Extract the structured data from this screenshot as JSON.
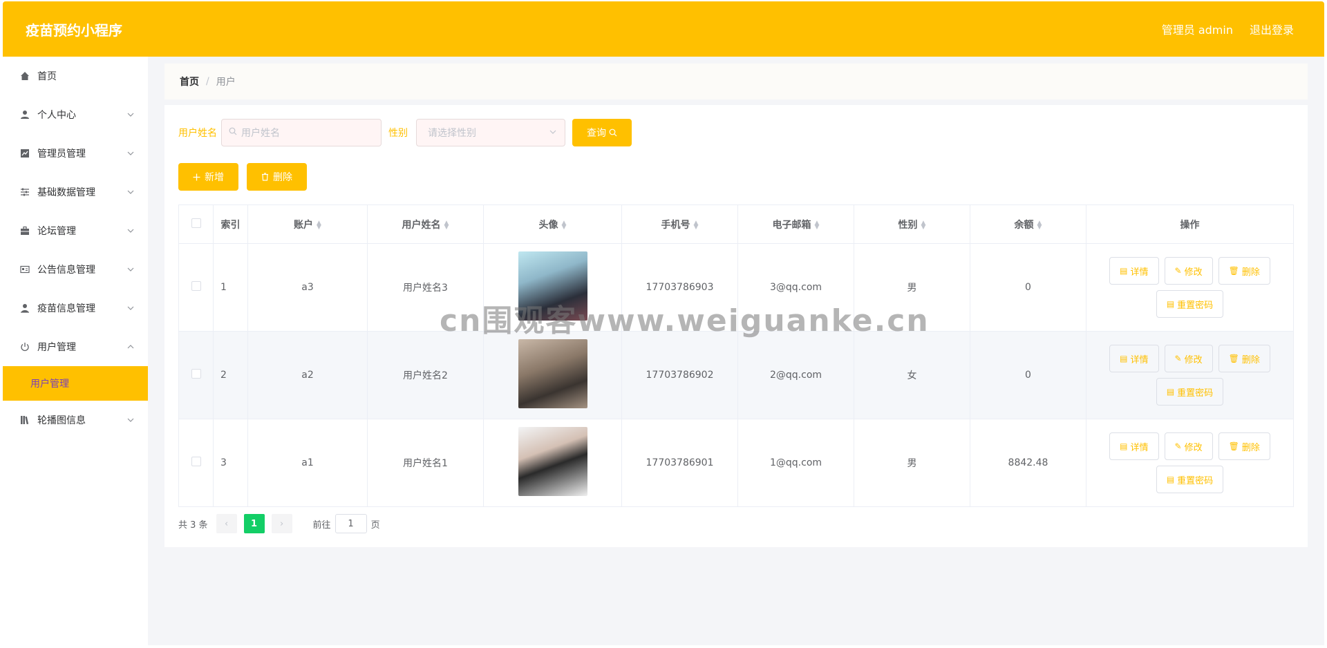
{
  "header": {
    "title": "疫苗预约小程序",
    "admin_label": "管理员 admin",
    "logout_label": "退出登录",
    "accent": "#FFC000"
  },
  "sidebar": {
    "items": [
      {
        "label": "首页",
        "icon": "home-icon"
      },
      {
        "label": "个人中心",
        "icon": "user-icon"
      },
      {
        "label": "管理员管理",
        "icon": "chart-icon"
      },
      {
        "label": "基础数据管理",
        "icon": "sliders-icon"
      },
      {
        "label": "论坛管理",
        "icon": "briefcase-icon"
      },
      {
        "label": "公告信息管理",
        "icon": "id-card-icon"
      },
      {
        "label": "疫苗信息管理",
        "icon": "person-icon"
      },
      {
        "label": "用户管理",
        "icon": "power-icon"
      },
      {
        "label": "轮播图信息",
        "icon": "library-icon"
      }
    ],
    "active_sub": "用户管理"
  },
  "breadcrumb": {
    "home": "首页",
    "sep": "/",
    "current": "用户"
  },
  "search": {
    "name_label": "用户姓名",
    "name_placeholder": "用户姓名",
    "gender_label": "性别",
    "gender_placeholder": "请选择性别",
    "query_button": "查询"
  },
  "actions": {
    "add": "新增",
    "delete": "删除"
  },
  "table": {
    "headers": [
      "索引",
      "账户",
      "用户姓名",
      "头像",
      "手机号",
      "电子邮箱",
      "性别",
      "余额",
      "操作"
    ],
    "rows": [
      {
        "index": "1",
        "account": "a3",
        "name": "用户姓名3",
        "phone": "17703786903",
        "email": "3@qq.com",
        "gender": "男",
        "balance": "0"
      },
      {
        "index": "2",
        "account": "a2",
        "name": "用户姓名2",
        "phone": "17703786902",
        "email": "2@qq.com",
        "gender": "女",
        "balance": "0"
      },
      {
        "index": "3",
        "account": "a1",
        "name": "用户姓名1",
        "phone": "17703786901",
        "email": "1@qq.com",
        "gender": "男",
        "balance": "8842.48"
      }
    ],
    "op_labels": {
      "detail": "详情",
      "edit": "修改",
      "delete": "删除",
      "reset": "重置密码"
    }
  },
  "pagination": {
    "total": "共 3 条",
    "current": "1",
    "goto_label": "前往",
    "goto_value": "1",
    "page_suffix": "页"
  },
  "watermark": "cn围观客www.weiguanke.cn"
}
